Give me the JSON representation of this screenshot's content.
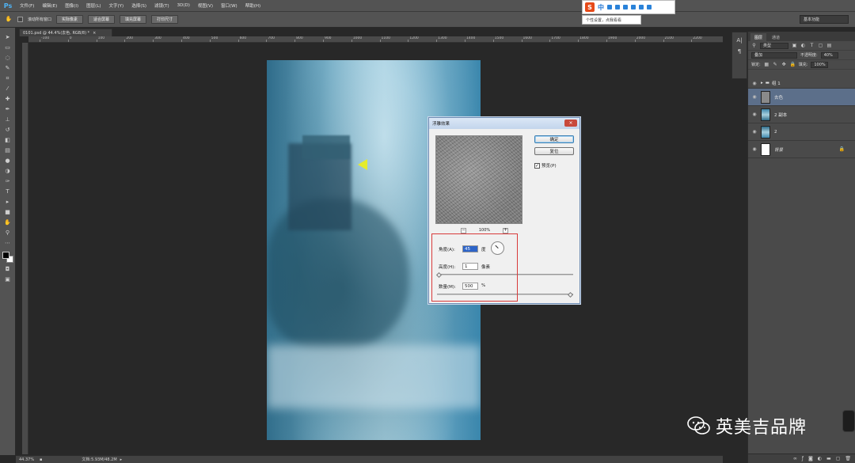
{
  "app": {
    "logo": "Ps"
  },
  "menu": [
    "文件(F)",
    "编辑(E)",
    "图像(I)",
    "图层(L)",
    "文字(Y)",
    "选择(S)",
    "滤镜(T)",
    "3D(D)",
    "视图(V)",
    "窗口(W)",
    "帮助(H)"
  ],
  "options_bar": {
    "scroll_all": "滚动所有窗口",
    "actual_pixels": "实际像素",
    "fit_screen": "适合屏幕",
    "fill_screen": "填充屏幕",
    "print_size": "打印尺寸",
    "workspace": "基本功能"
  },
  "ime": {
    "logo": "S",
    "lang": "中",
    "tooltip": "个性设置，点我看看"
  },
  "document": {
    "tab_title": "0101.psd @ 44.4%(去色, RGB/8) *",
    "ruler_marks": [
      "-100",
      "0",
      "100",
      "200",
      "300",
      "400",
      "500",
      "600",
      "700",
      "800",
      "900",
      "1000",
      "1100",
      "1200",
      "1300",
      "1400",
      "1500",
      "1600",
      "1700",
      "1800",
      "1900",
      "2000",
      "2100",
      "2200"
    ]
  },
  "dialog": {
    "title": "浮雕效果",
    "ok": "确定",
    "reset": "复位",
    "preview_label": "预览(P)",
    "preview_checked": true,
    "zoom": "100%",
    "angle_label": "角度(A):",
    "angle_value": "45",
    "angle_unit": "度",
    "height_label": "高度(H):",
    "height_value": "1",
    "height_unit": "像素",
    "amount_label": "数量(M):",
    "amount_value": "500",
    "amount_unit": "%",
    "height_slider_fraction": 0.0,
    "amount_slider_fraction": 1.0
  },
  "layers_panel": {
    "tabs": [
      "图层",
      "通道"
    ],
    "kind_filter": "类型",
    "blend_mode": "叠加",
    "opacity_label": "不透明度:",
    "opacity_value": "40%",
    "lock_label": "锁定:",
    "fill_label": "填充:",
    "fill_value": "100%",
    "layers": [
      {
        "name": "组 1",
        "type": "group",
        "selected": false
      },
      {
        "name": "去色",
        "type": "layer",
        "selected": true
      },
      {
        "name": "2 副本",
        "type": "layer",
        "selected": false
      },
      {
        "name": "2",
        "type": "layer",
        "selected": false
      },
      {
        "name": "背景",
        "type": "background",
        "selected": false
      }
    ]
  },
  "status": {
    "zoom": "44.37%",
    "doc_size": "文档:5.93M/48.2M"
  },
  "watermark": {
    "text": "英美吉品牌"
  },
  "colors": {
    "highlight": "#d83a3a",
    "selected_layer": "#5c6f8a"
  }
}
